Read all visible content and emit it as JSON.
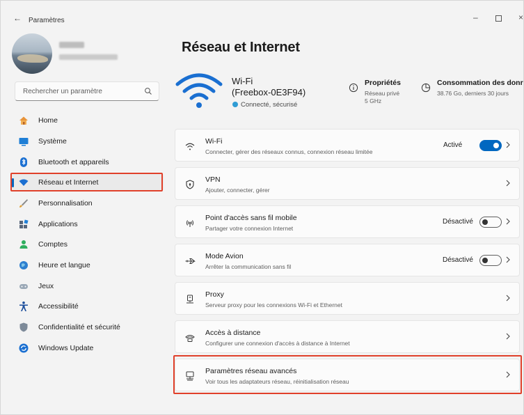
{
  "window": {
    "title": "Paramètres",
    "back_glyph": "←",
    "controls": {
      "minimize": "–",
      "close": "×"
    }
  },
  "search": {
    "placeholder": "Rechercher un paramètre"
  },
  "sidebar": {
    "items": [
      {
        "label": "Home",
        "icon": "home-icon"
      },
      {
        "label": "Système",
        "icon": "system-icon"
      },
      {
        "label": "Bluetooth et appareils",
        "icon": "bluetooth-icon"
      },
      {
        "label": "Réseau et Internet",
        "icon": "network-icon",
        "selected": true
      },
      {
        "label": "Personnalisation",
        "icon": "brush-icon"
      },
      {
        "label": "Applications",
        "icon": "apps-icon"
      },
      {
        "label": "Comptes",
        "icon": "accounts-icon"
      },
      {
        "label": "Heure et langue",
        "icon": "time-language-icon"
      },
      {
        "label": "Jeux",
        "icon": "gamepad-icon"
      },
      {
        "label": "Accessibilité",
        "icon": "accessibility-icon"
      },
      {
        "label": "Confidentialité et sécurité",
        "icon": "shield-icon"
      },
      {
        "label": "Windows Update",
        "icon": "windows-update-icon"
      }
    ]
  },
  "main": {
    "title": "Réseau et Internet",
    "hero": {
      "network_type": "Wi-Fi",
      "network_name": "(Freebox-0E3F94)",
      "status": "Connecté, sécurisé"
    },
    "properties": {
      "title": "Propriétés",
      "line1": "Réseau privé",
      "line2": "5 GHz"
    },
    "data_usage": {
      "title": "Consommation des donr",
      "line1": "38.76 Go, derniers 30 jours"
    },
    "cards": [
      {
        "title": "Wi-Fi",
        "subtitle": "Connecter, gérer des réseaux connus, connexion réseau limitée",
        "state": "Activé",
        "toggle": "on",
        "icon": "wifi-icon"
      },
      {
        "title": "VPN",
        "subtitle": "Ajouter, connecter, gérer",
        "icon": "vpn-shield-icon"
      },
      {
        "title": "Point d'accès sans fil mobile",
        "subtitle": "Partager votre connexion Internet",
        "state": "Désactivé",
        "toggle": "off",
        "icon": "hotspot-icon"
      },
      {
        "title": "Mode Avion",
        "subtitle": "Arrêter la communication sans fil",
        "state": "Désactivé",
        "toggle": "off",
        "icon": "airplane-icon"
      },
      {
        "title": "Proxy",
        "subtitle": "Serveur proxy pour les connexions Wi-Fi et Ethernet",
        "icon": "proxy-icon"
      },
      {
        "title": "Accès à distance",
        "subtitle": "Configurer une connexion d'accès à distance à Internet",
        "icon": "dialup-icon"
      },
      {
        "title": "Paramètres réseau avancés",
        "subtitle": "Voir tous les adaptateurs réseau, réinitialisation réseau",
        "icon": "advanced-network-icon",
        "highlighted": true
      }
    ]
  },
  "colors": {
    "accent": "#0067c0",
    "highlight": "#e0402a",
    "background": "#f3f3f3",
    "card": "#fbfbfb"
  }
}
